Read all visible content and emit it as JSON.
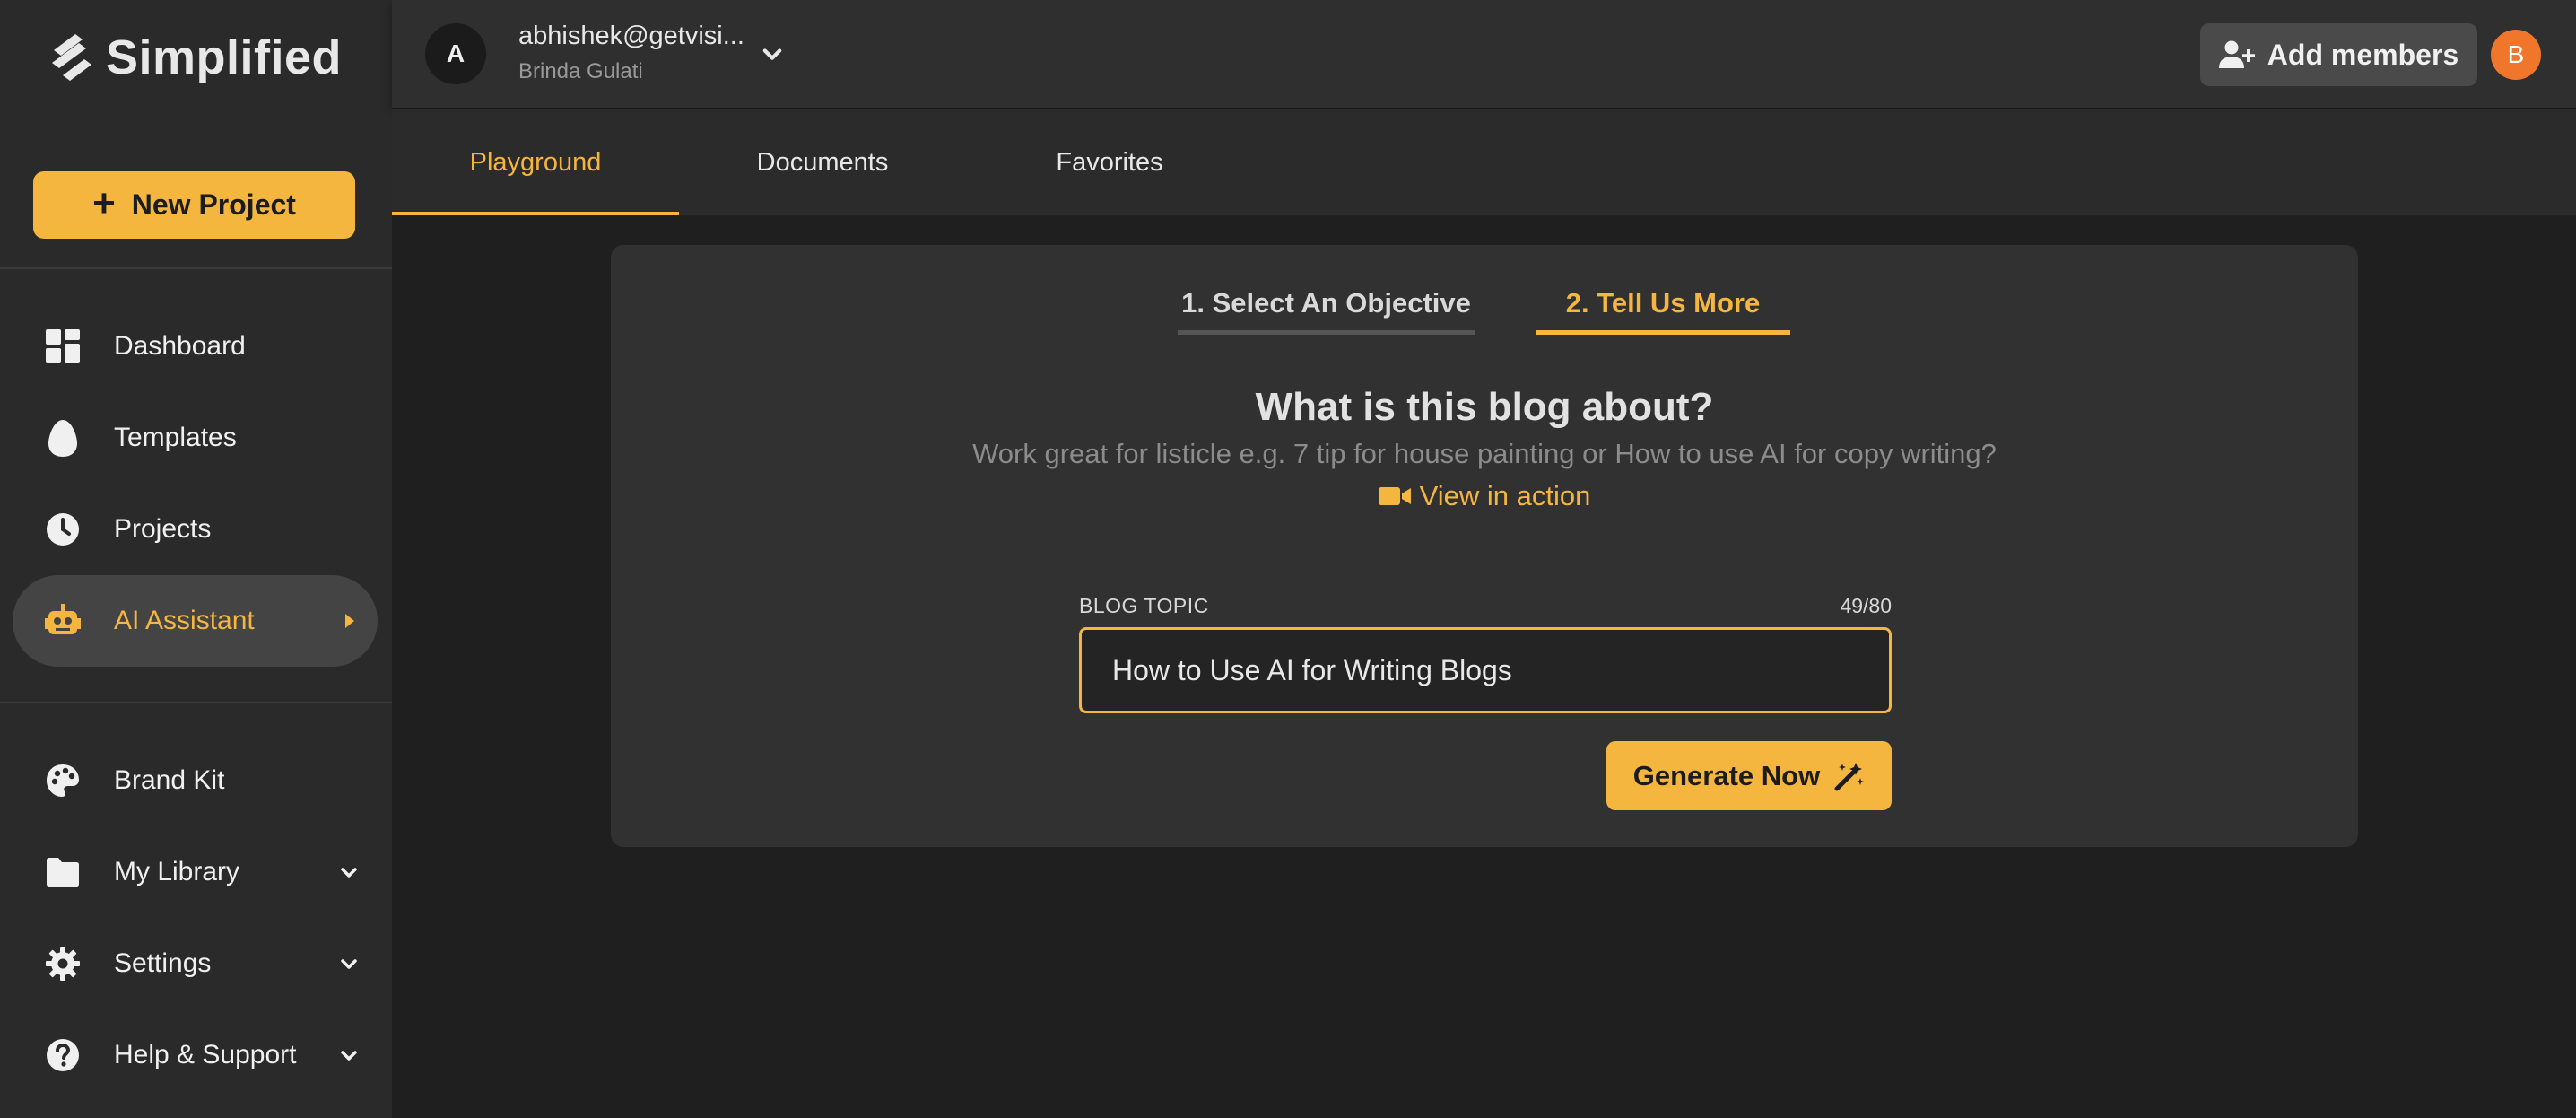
{
  "app": {
    "logo_text": "Simplified"
  },
  "sidebar": {
    "new_project_label": "New Project",
    "nav": [
      {
        "label": "Dashboard",
        "icon": "grid-icon"
      },
      {
        "label": "Templates",
        "icon": "egg-icon"
      },
      {
        "label": "Projects",
        "icon": "clock-icon"
      },
      {
        "label": "AI Assistant",
        "icon": "robot-icon",
        "active": true
      },
      {
        "label": "Brand Kit",
        "icon": "palette-icon"
      },
      {
        "label": "My Library",
        "icon": "folder-icon"
      },
      {
        "label": "Settings",
        "icon": "gear-icon"
      },
      {
        "label": "Help & Support",
        "icon": "help-circle-icon"
      }
    ]
  },
  "header": {
    "account_initial": "A",
    "account_email": "abhishek@getvisi...",
    "account_name": "Brinda Gulati",
    "add_members_label": "Add members",
    "user_initial": "B"
  },
  "tabs": [
    {
      "label": "Playground",
      "active": true
    },
    {
      "label": "Documents"
    },
    {
      "label": "Favorites"
    }
  ],
  "wizard": {
    "steps": [
      "1. Select An Objective",
      "2. Tell Us More"
    ],
    "active_step": 1,
    "title": "What is this blog about?",
    "subtitle": "Work great for listicle e.g. 7 tip for house painting or How to use AI for copy writing?",
    "view_in_action": "View in action",
    "field_label": "BLOG TOPIC",
    "field_count": "49/80",
    "field_value": "How to Use AI for Writing Blogs",
    "generate_label": "Generate Now"
  },
  "colors": {
    "accent": "#f5b63f",
    "sidebar_bg": "#2a2a2a",
    "page_bg": "#1f1f1f",
    "card_bg": "#313131",
    "avatar": "#f0762b"
  }
}
